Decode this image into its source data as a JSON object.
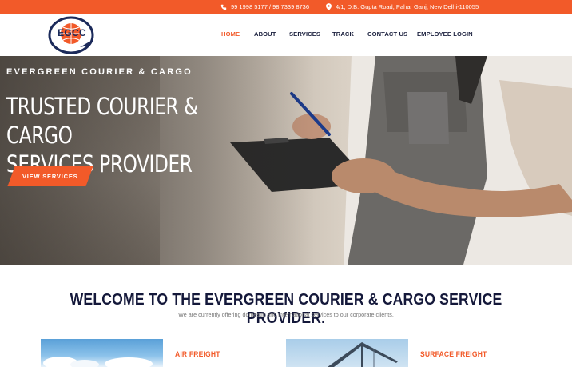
{
  "topbar": {
    "phone": "99 1998 5177 / 98 7339 8736",
    "address": "4/1, D.B. Gupta Road, Pahar Ganj, New Delhi-110055",
    "phone_icon": "phone-icon",
    "address_icon": "map-pin-icon"
  },
  "logo": {
    "text": "EGCC"
  },
  "nav": {
    "home": "HOME",
    "about": "ABOUT",
    "services": "SERVICES",
    "track": "TRACK",
    "contact": "CONTACT US",
    "employee": "EMPLOYEE LOGIN"
  },
  "hero": {
    "subtitle": "EVERGREEN COURIER & CARGO",
    "title_line1": "TRUSTED COURIER & CARGO",
    "title_line2": "SERVICES PROVIDER",
    "button": "VIEW SERVICES"
  },
  "welcome": {
    "title": "WELCOME TO THE EVERGREEN COURIER & CARGO SERVICE PROVIDER.",
    "subtitle": "We are currently offering domestic and international services to our corporate clients."
  },
  "services": [
    {
      "title": "AIR FREIGHT"
    },
    {
      "title": "SURFACE FREIGHT"
    }
  ],
  "colors": {
    "accent": "#f25a29",
    "navy": "#14183a"
  }
}
